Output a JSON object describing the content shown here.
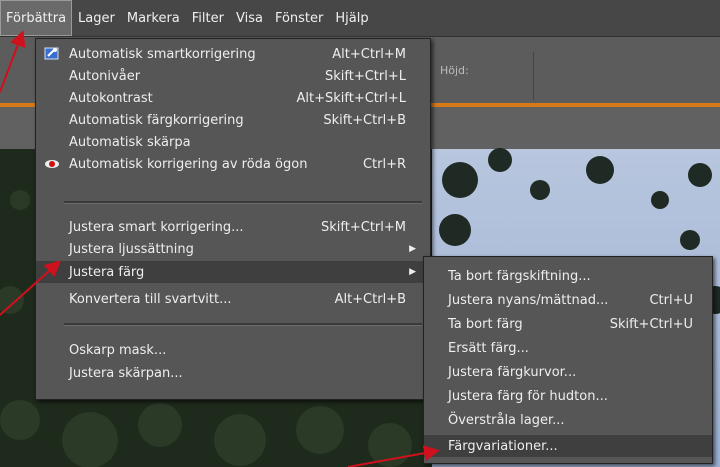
{
  "menubar": {
    "items": [
      "Förbättra",
      "Lager",
      "Markera",
      "Filter",
      "Visa",
      "Fönster",
      "Hjälp"
    ]
  },
  "toolbar": {
    "hojd_label": "Höjd:"
  },
  "main_menu": {
    "items": [
      {
        "label": "Automatisk smartkorrigering",
        "shortcut": "Alt+Ctrl+M"
      },
      {
        "label": "Autonivåer",
        "shortcut": "Skift+Ctrl+L"
      },
      {
        "label": "Autokontrast",
        "shortcut": "Alt+Skift+Ctrl+L"
      },
      {
        "label": "Automatisk färgkorrigering",
        "shortcut": "Skift+Ctrl+B"
      },
      {
        "label": "Automatisk skärpa",
        "shortcut": ""
      },
      {
        "label": "Automatisk korrigering av röda ögon",
        "shortcut": "Ctrl+R"
      },
      {
        "label": "Justera smart korrigering...",
        "shortcut": "Skift+Ctrl+M"
      },
      {
        "label": "Justera ljussättning",
        "shortcut": ""
      },
      {
        "label": "Justera färg",
        "shortcut": ""
      },
      {
        "label": "Konvertera till svartvitt...",
        "shortcut": "Alt+Ctrl+B"
      },
      {
        "label": "Oskarp mask...",
        "shortcut": ""
      },
      {
        "label": "Justera skärpan...",
        "shortcut": ""
      }
    ]
  },
  "sub_menu": {
    "items": [
      {
        "label": "Ta bort färgskiftning...",
        "shortcut": ""
      },
      {
        "label": "Justera nyans/mättnad...",
        "shortcut": "Ctrl+U"
      },
      {
        "label": "Ta bort färg",
        "shortcut": "Skift+Ctrl+U"
      },
      {
        "label": "Ersätt färg...",
        "shortcut": ""
      },
      {
        "label": "Justera färgkurvor...",
        "shortcut": ""
      },
      {
        "label": "Justera färg för hudton...",
        "shortcut": ""
      },
      {
        "label": "Överstråla lager...",
        "shortcut": ""
      },
      {
        "label": "Färgvariationer...",
        "shortcut": ""
      }
    ]
  },
  "colors": {
    "accent_orange": "#d67a17",
    "annotation_arrow": "#d0101c",
    "highlight": "#3f3f3f"
  }
}
